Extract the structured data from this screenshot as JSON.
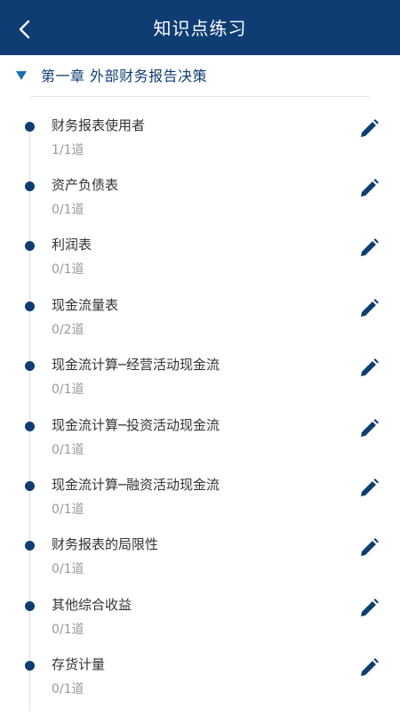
{
  "header": {
    "title": "知识点练习",
    "background_color": "#0f3d73",
    "back_icon": "chevron-left-icon"
  },
  "chapter": {
    "expand_icon": "triangle-down-icon",
    "title": "第一章  外部财务报告决策",
    "color": "#0f3d73"
  },
  "items": [
    {
      "name": "财务报表使用者",
      "count": "1/1道"
    },
    {
      "name": "资产负债表",
      "count": "0/1道"
    },
    {
      "name": "利润表",
      "count": "0/1道"
    },
    {
      "name": "现金流量表",
      "count": "0/2道"
    },
    {
      "name": "现金流计算─经营活动现金流",
      "count": "0/1道"
    },
    {
      "name": "现金流计算─投资活动现金流",
      "count": "0/1道"
    },
    {
      "name": "现金流计算─融资活动现金流",
      "count": "0/1道"
    },
    {
      "name": "财务报表的局限性",
      "count": "0/1道"
    },
    {
      "name": "其他综合收益",
      "count": "0/1道"
    },
    {
      "name": "存货计量",
      "count": "0/1道"
    }
  ],
  "item_action_icon": "pencil-icon"
}
